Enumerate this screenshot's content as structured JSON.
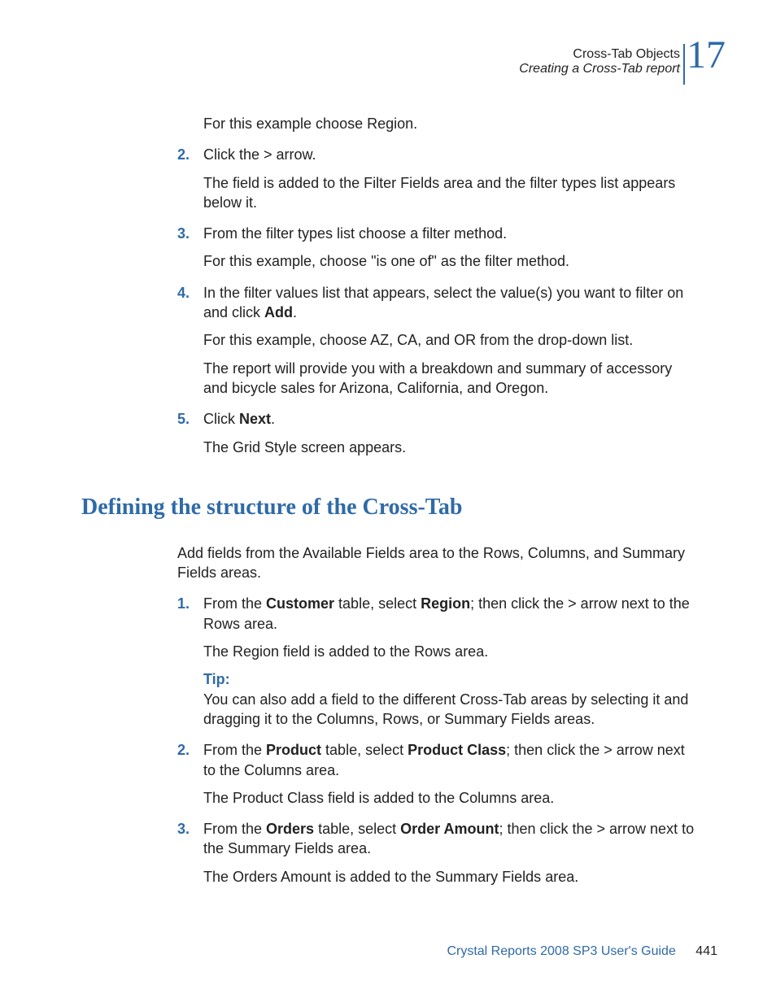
{
  "header": {
    "line1": "Cross-Tab Objects",
    "line2": "Creating a Cross-Tab report",
    "chapter": "17"
  },
  "section1": {
    "p1": "For this example choose Region.",
    "step2_num": "2.",
    "step2_text": "Click the > arrow.",
    "step2_after": "The field is added to the Filter Fields area and the filter types list appears below it.",
    "step3_num": "3.",
    "step3_text": "From the filter types list choose a filter method.",
    "step3_after": "For this example, choose \"is one of\" as the filter method.",
    "step4_num": "4.",
    "step4_pre": "In the filter values list that appears, select the value(s) you want to filter on and click ",
    "step4_bold": "Add",
    "step4_post": ".",
    "step4_after_a": "For this example, choose AZ, CA, and OR from the drop-down list.",
    "step4_after_b": "The report will provide you with a breakdown and summary of accessory and bicycle sales for Arizona, California, and Oregon.",
    "step5_num": "5.",
    "step5_pre": "Click ",
    "step5_bold": "Next",
    "step5_post": ".",
    "step5_after": "The Grid Style screen appears."
  },
  "heading2": "Defining the structure of the Cross-Tab",
  "section2": {
    "intro": "Add fields from the Available Fields area to the Rows, Columns, and Summary Fields areas.",
    "s1_num": "1.",
    "s1_pre": "From the ",
    "s1_b1": "Customer",
    "s1_mid": " table, select ",
    "s1_b2": "Region",
    "s1_post": "; then click the > arrow next to the Rows area.",
    "s1_after": "The Region field is added to the Rows area.",
    "tip_label": "Tip:",
    "tip_body": "You can also add a field to the different Cross-Tab areas by selecting it and dragging it to the Columns, Rows, or Summary Fields areas.",
    "s2_num": "2.",
    "s2_pre": "From the ",
    "s2_b1": "Product",
    "s2_mid": " table, select ",
    "s2_b2": "Product Class",
    "s2_post": "; then click the > arrow next to the Columns area.",
    "s2_after": "The Product Class field is added to the Columns area.",
    "s3_num": "3.",
    "s3_pre": "From the ",
    "s3_b1": "Orders",
    "s3_mid": " table, select ",
    "s3_b2": "Order Amount",
    "s3_post": "; then click the > arrow next to the Summary Fields area.",
    "s3_after": "The Orders Amount is added to the Summary Fields area."
  },
  "footer": {
    "title": "Crystal Reports 2008 SP3 User's Guide",
    "page": "441"
  }
}
